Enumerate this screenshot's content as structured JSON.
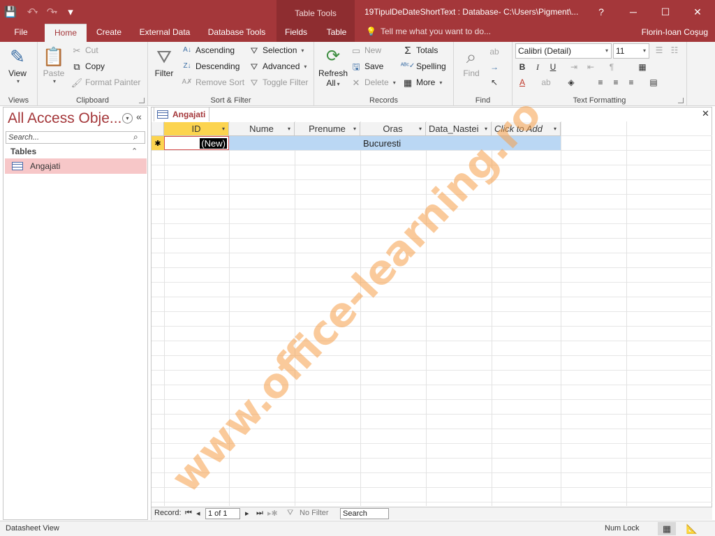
{
  "titlebar": {
    "context_tab_group": "Table Tools",
    "window_title": "19TipulDeDateShortText : Database- C:\\Users\\Pigment\\...",
    "help": "?",
    "minimize": "─",
    "maximize": "☐",
    "close": "✕",
    "qat": {
      "save_icon": "💾",
      "undo_icon": "↶",
      "redo_icon": "↷",
      "customize_icon": "▾"
    }
  },
  "tabs": [
    "File",
    "Home",
    "Create",
    "External Data",
    "Database Tools",
    "Fields",
    "Table"
  ],
  "active_tab": "Home",
  "tell_me": "Tell me what you want to do...",
  "user": "Florin-Ioan Coşug",
  "ribbon": {
    "views": {
      "view": "View",
      "label": "Views"
    },
    "clipboard": {
      "paste": "Paste",
      "cut": "Cut",
      "copy": "Copy",
      "format_painter": "Format Painter",
      "label": "Clipboard"
    },
    "sort_filter": {
      "filter": "Filter",
      "ascending": "Ascending",
      "descending": "Descending",
      "remove_sort": "Remove Sort",
      "selection": "Selection",
      "advanced": "Advanced",
      "toggle_filter": "Toggle Filter",
      "label": "Sort & Filter"
    },
    "records": {
      "refresh": "Refresh",
      "refresh_all": "All",
      "new": "New",
      "save": "Save",
      "delete": "Delete",
      "totals": "Totals",
      "spelling": "Spelling",
      "more": "More",
      "label": "Records"
    },
    "find": {
      "find": "Find",
      "label": "Find"
    },
    "text_formatting": {
      "font": "Calibri (Detail)",
      "size": "11",
      "bold": "B",
      "italic": "I",
      "underline": "U",
      "label": "Text Formatting"
    }
  },
  "nav_pane": {
    "title": "All Access Obje...",
    "search_placeholder": "Search...",
    "section": "Tables",
    "items": [
      "Angajati"
    ]
  },
  "document": {
    "tab": "Angajati",
    "columns": [
      "ID",
      "Nume",
      "Prenume",
      "Oras",
      "Data_Nastei",
      "Click to Add"
    ],
    "new_row": {
      "id": "(New)",
      "nume": "",
      "prenume": "",
      "oras": "Bucuresti",
      "data_nasterii": ""
    },
    "new_row_marker": "✱"
  },
  "record_nav": {
    "label": "Record:",
    "position": "1 of 1",
    "filter": "No Filter",
    "search": "Search"
  },
  "watermark": "www.office-learning.ro",
  "status": {
    "view": "Datasheet View",
    "num_lock": "Num Lock"
  },
  "colors": {
    "accent": "#a4373a",
    "selected_header": "#fcd44f",
    "selected_row": "#bad7f4",
    "nav_selected": "#f7c7c8"
  }
}
